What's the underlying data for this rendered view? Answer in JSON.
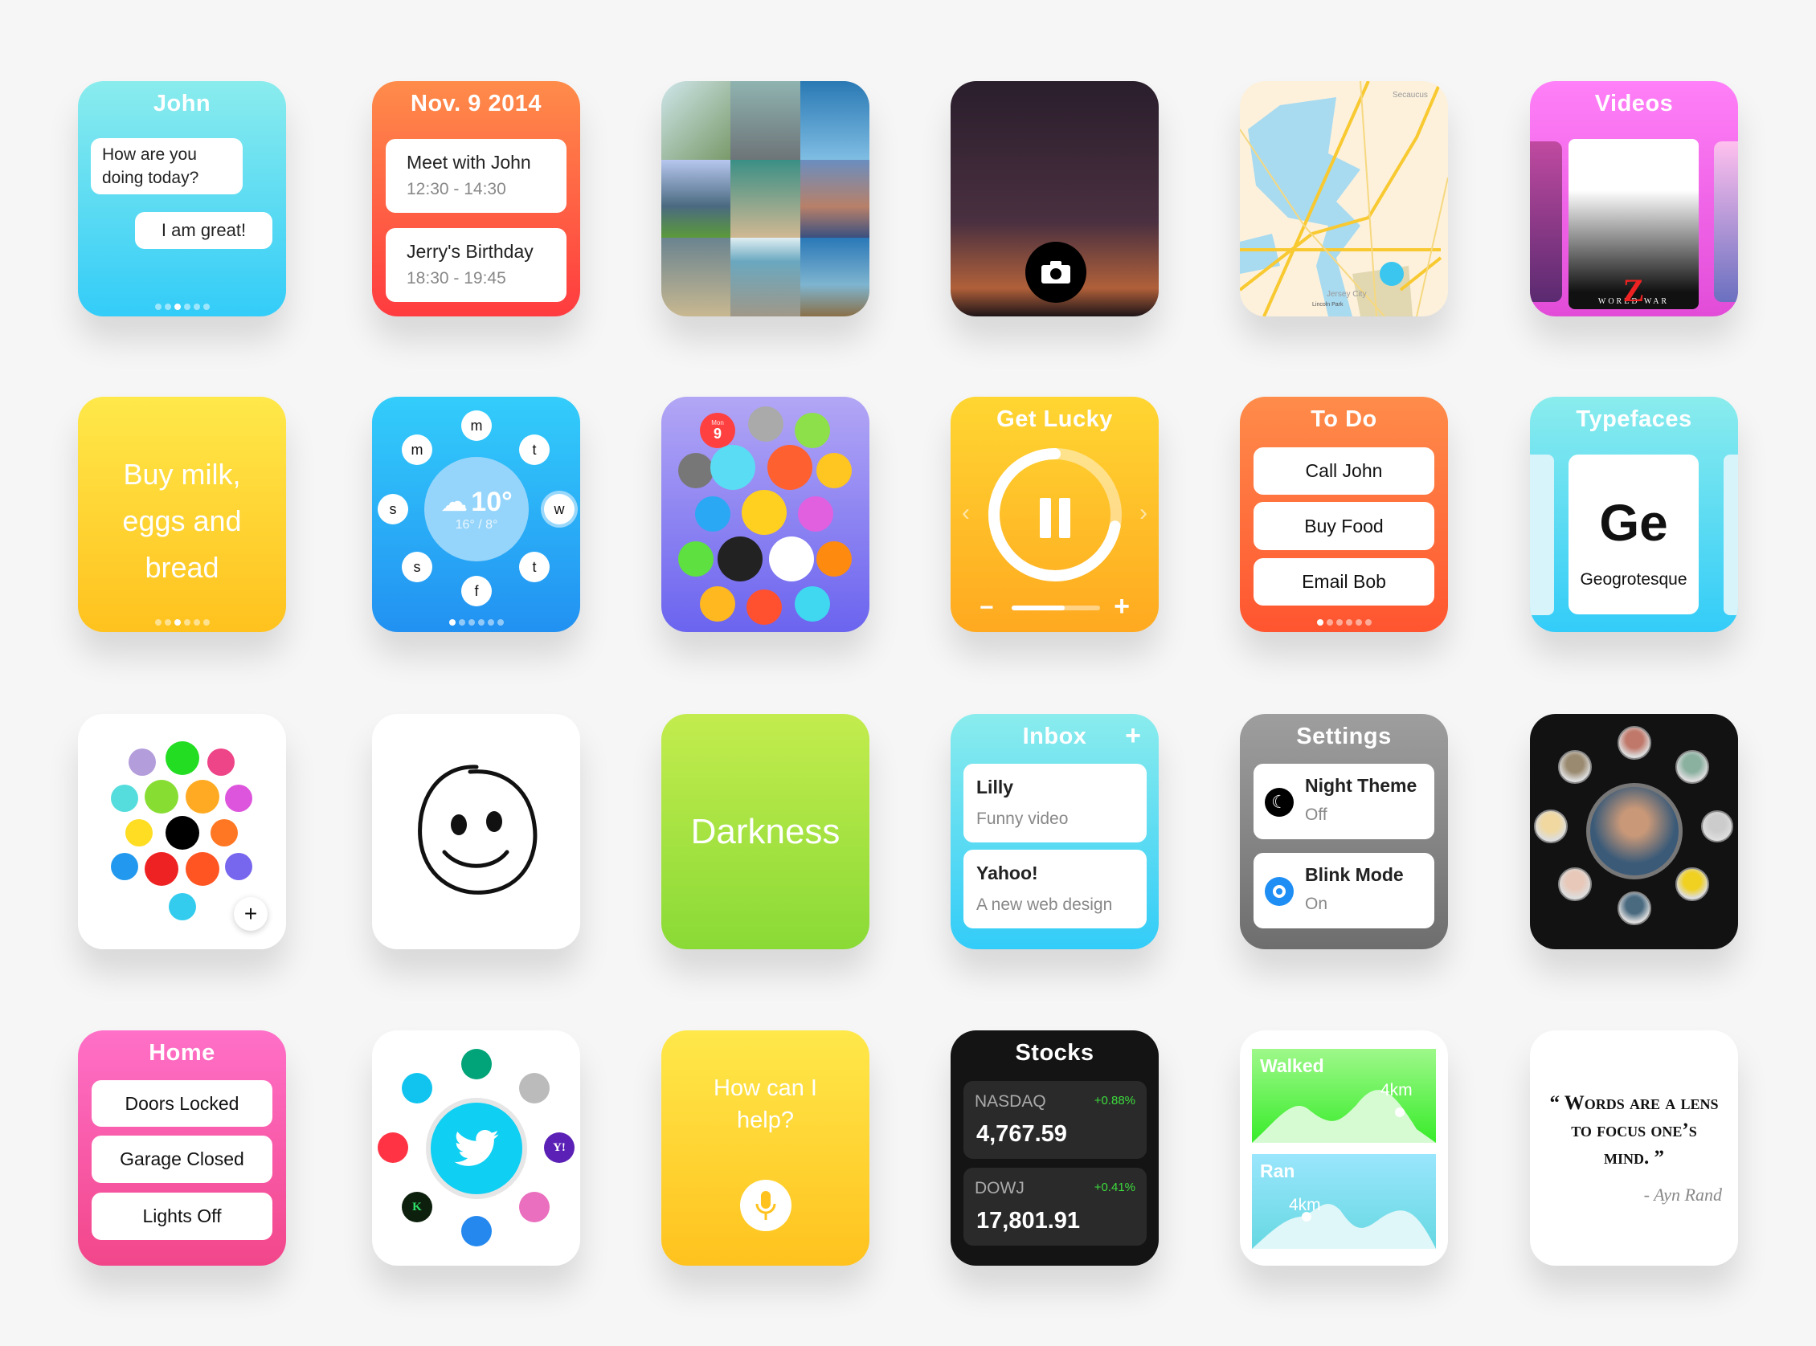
{
  "messages": {
    "title": "John",
    "incoming": "How are you doing today?",
    "outgoing": "I am great!",
    "page_index": 3,
    "page_count": 6
  },
  "calendar": {
    "title": "Nov. 9 2014",
    "events": [
      {
        "name": "Meet with John",
        "time": "12:30 - 14:30"
      },
      {
        "name": "Jerry's Birthday",
        "time": "18:30 - 19:45"
      }
    ]
  },
  "camera": {
    "icon": "camera-icon"
  },
  "map": {
    "labels": [
      "Secaucus",
      "Jersey City",
      "Lincoln Park"
    ]
  },
  "videos": {
    "title": "Videos",
    "poster_text": "WORLD WAR",
    "poster_letter": "Z"
  },
  "note": {
    "text": "Buy milk, eggs and bread",
    "page_index": 3,
    "page_count": 6
  },
  "weather": {
    "temp": "10°",
    "range": "16° / 8°",
    "days": [
      "m",
      "t",
      "w",
      "t",
      "f",
      "s",
      "s",
      "m"
    ],
    "selected_day": 2,
    "page_index": 1,
    "page_count": 6
  },
  "apps": {
    "calendar_day": "Mon",
    "calendar_date": "9"
  },
  "music": {
    "title": "Get Lucky",
    "progress": 0.72,
    "volume": 0.6,
    "prev": "‹",
    "next": "›",
    "vol_down": "−",
    "vol_up": "+"
  },
  "todo": {
    "title": "To Do",
    "items": [
      "Call John",
      "Buy Food",
      "Email Bob"
    ],
    "page_index": 1,
    "page_count": 6
  },
  "typefaces": {
    "title": "Typefaces",
    "sample": "Ge",
    "font_name": "Geogrotesque"
  },
  "colors": {
    "swatches": [
      "#b39ddb",
      "#22dd22",
      "#ee4488",
      "#55dddd",
      "#88dd33",
      "#ffaa22",
      "#dd55dd",
      "#ffdd22",
      "#000000",
      "#ff7722",
      "#2299ee",
      "#ee2222",
      "#ff5522",
      "#7766ee",
      "#33ccee"
    ],
    "add": "+"
  },
  "darkness": {
    "text": "Darkness"
  },
  "inbox": {
    "title": "Inbox",
    "add": "+",
    "messages": [
      {
        "from": "Lilly",
        "subject": "Funny video"
      },
      {
        "from": "Yahoo!",
        "subject": "A new web design"
      }
    ]
  },
  "settings": {
    "title": "Settings",
    "items": [
      {
        "name": "Night Theme",
        "value": "Off",
        "icon": "moon-icon"
      },
      {
        "name": "Blink Mode",
        "value": "On",
        "icon": "eye-icon"
      }
    ]
  },
  "home": {
    "title": "Home",
    "items": [
      "Doors Locked",
      "Garage Closed",
      "Lights Off"
    ]
  },
  "social": {
    "center": "twitter",
    "apps": [
      {
        "name": "vine",
        "color": "#00a478"
      },
      {
        "name": "apple",
        "color": "#bbbbbb"
      },
      {
        "name": "yahoo",
        "color": "#5b21b6",
        "glyph": "Y!"
      },
      {
        "name": "dribbble",
        "color": "#ea6fbe"
      },
      {
        "name": "periscope",
        "color": "#2588ee"
      },
      {
        "name": "kickstarter",
        "color": "#0d200d",
        "glyph": "K"
      },
      {
        "name": "youtube",
        "color": "#ff3344"
      },
      {
        "name": "twitter",
        "color": "#10c4ef"
      }
    ]
  },
  "assistant": {
    "prompt": "How can I help?"
  },
  "stocks": {
    "title": "Stocks",
    "items": [
      {
        "symbol": "NASDAQ",
        "change": "+0.88%",
        "value": "4,767.59"
      },
      {
        "symbol": "DOWJ",
        "change": "+0.41%",
        "value": "17,801.91"
      }
    ]
  },
  "fitness": {
    "walked_label": "Walked",
    "walked_value": "4km",
    "ran_label": "Ran",
    "ran_value": "4km"
  },
  "quote": {
    "text": "“ Words are a lens to focus one’s mind. ”",
    "author": "- Ayn Rand"
  }
}
